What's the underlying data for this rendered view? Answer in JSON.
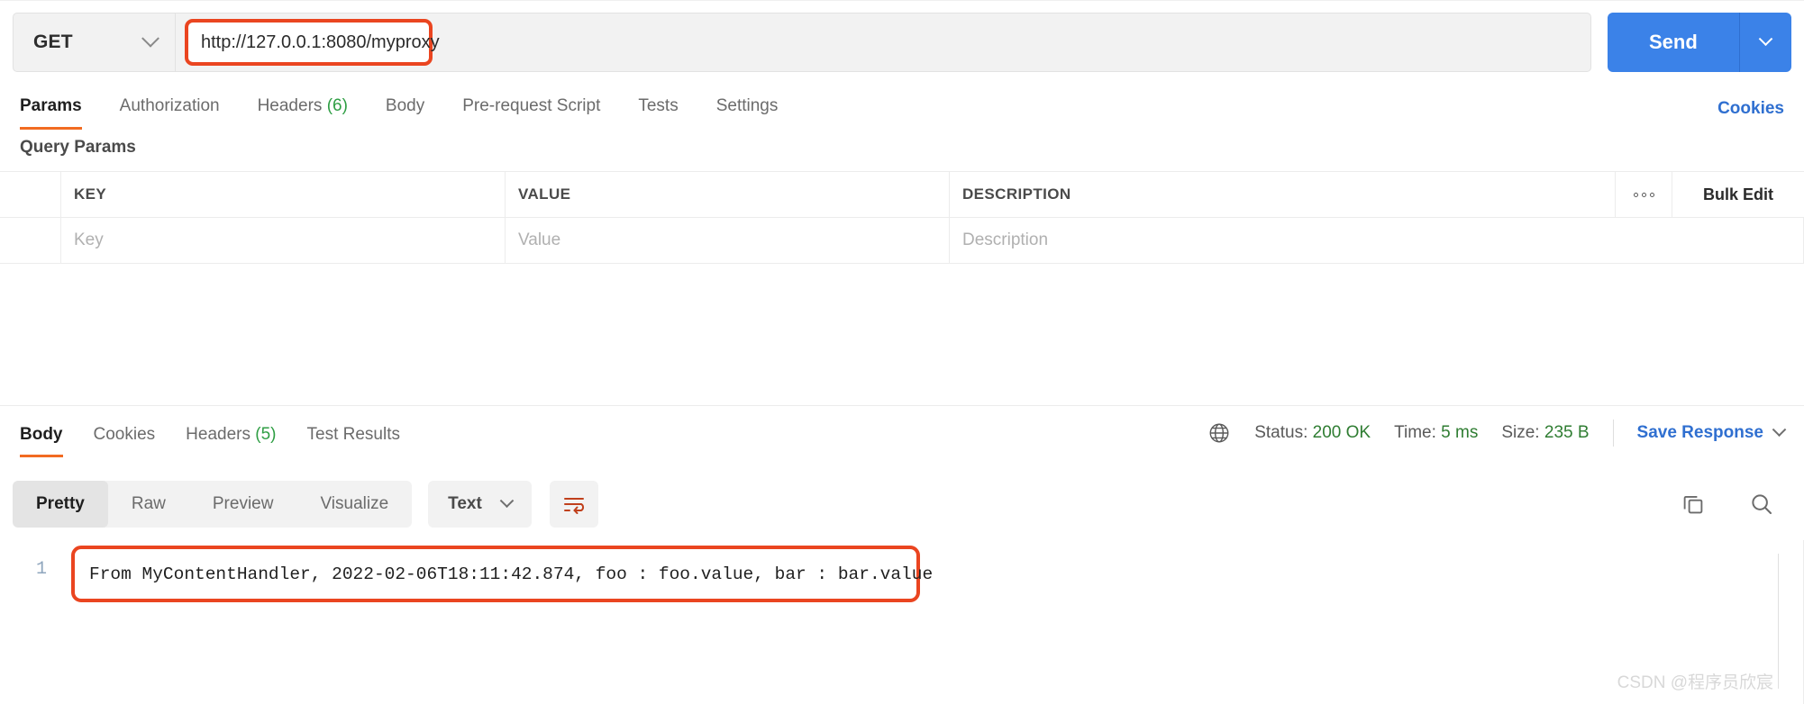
{
  "request": {
    "method": "GET",
    "url": "http://127.0.0.1:8080/myproxy",
    "send_label": "Send",
    "tabs": [
      {
        "label": "Params",
        "count": ""
      },
      {
        "label": "Authorization",
        "count": ""
      },
      {
        "label": "Headers",
        "count": "(6)"
      },
      {
        "label": "Body",
        "count": ""
      },
      {
        "label": "Pre-request Script",
        "count": ""
      },
      {
        "label": "Tests",
        "count": ""
      },
      {
        "label": "Settings",
        "count": ""
      }
    ],
    "cookies_link": "Cookies"
  },
  "query_params": {
    "section_title": "Query Params",
    "headers": {
      "key": "KEY",
      "value": "VALUE",
      "description": "DESCRIPTION"
    },
    "bulk_edit": "Bulk Edit",
    "rows": [
      {
        "key": "Key",
        "value": "Value",
        "description": "Description"
      }
    ]
  },
  "response": {
    "tabs": [
      {
        "label": "Body",
        "count": ""
      },
      {
        "label": "Cookies",
        "count": ""
      },
      {
        "label": "Headers",
        "count": "(5)"
      },
      {
        "label": "Test Results",
        "count": ""
      }
    ],
    "status_label": "Status:",
    "status_value": "200 OK",
    "time_label": "Time:",
    "time_value": "5 ms",
    "size_label": "Size:",
    "size_value": "235 B",
    "save_response": "Save Response",
    "view_modes": [
      "Pretty",
      "Raw",
      "Preview",
      "Visualize"
    ],
    "active_view": "Pretty",
    "format": "Text",
    "line_number": "1",
    "body_text": "From MyContentHandler, 2022-02-06T18:11:42.874, foo : foo.value, bar : bar.value"
  },
  "watermark": "CSDN @程序员欣宸",
  "colors": {
    "accent_orange": "#f26b21",
    "highlight_red": "#ea4520",
    "brand_blue": "#3b82e8",
    "link_blue": "#2f6fd0",
    "success_green": "#2f7d32",
    "count_green": "#2f9e44"
  }
}
